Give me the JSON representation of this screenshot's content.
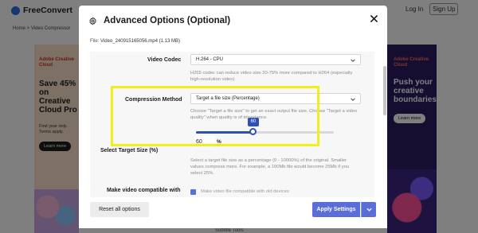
{
  "background_page": {
    "logo_text": "FreeConvert",
    "login_label": "Log In",
    "signup_label": "Sign Up",
    "breadcrumb": "Home  >  Video Compressor",
    "left_ad": {
      "brand": "Adobe Creative Cloud",
      "headline": "Save 45% on Creative Cloud Pro",
      "subtext": "First year only. Terms apply.",
      "button": "Learn more"
    },
    "right_ad": {
      "brand": "Adobe Creative Cloud",
      "headline": "Push your creative boundaries.",
      "button": "Learn more"
    },
    "bottom_text": "Subtitle Tools"
  },
  "modal": {
    "title": "Advanced Options (Optional)",
    "file_label": "File:",
    "file_name": "Video_240915165056.mp4 (1.13 MB)",
    "video_codec": {
      "label": "Video Codec",
      "value": "H.264 - CPU",
      "help": "H265 codec can reduce video size 20-75% more compared to H264 (especially high-resolution video)"
    },
    "compression_method": {
      "label": "Compression Method",
      "value": "Target a file size (Percentage)",
      "help": "Choose \"Target a file size\" to get an exact output file size. Choose \"Target a video quality\" when quality is of importance.",
      "slider_value": 60,
      "slider_min": 0,
      "slider_max": 100,
      "input_value": "60",
      "unit": "%"
    },
    "select_target_size": {
      "label": "Select Target Size (%)",
      "help": "Select a target file size as a percentage (0 - 10000%) of the original. Smaller values compress more. For example, a 100Mb file would become 25Mb if you select 25%."
    },
    "compatibility": {
      "label": "Make video compatible with",
      "help": "Make video file compatible with old devices"
    },
    "footer": {
      "reset_label": "Reset all options",
      "apply_label": "Apply Settings"
    }
  },
  "colors": {
    "accent": "#5a6ed9",
    "highlight": "#f2ee1a",
    "slider": "#2f4fb8"
  },
  "icons": {
    "settings": "gear-icon",
    "close": "close-icon",
    "dropdown": "chevron-down-icon"
  }
}
